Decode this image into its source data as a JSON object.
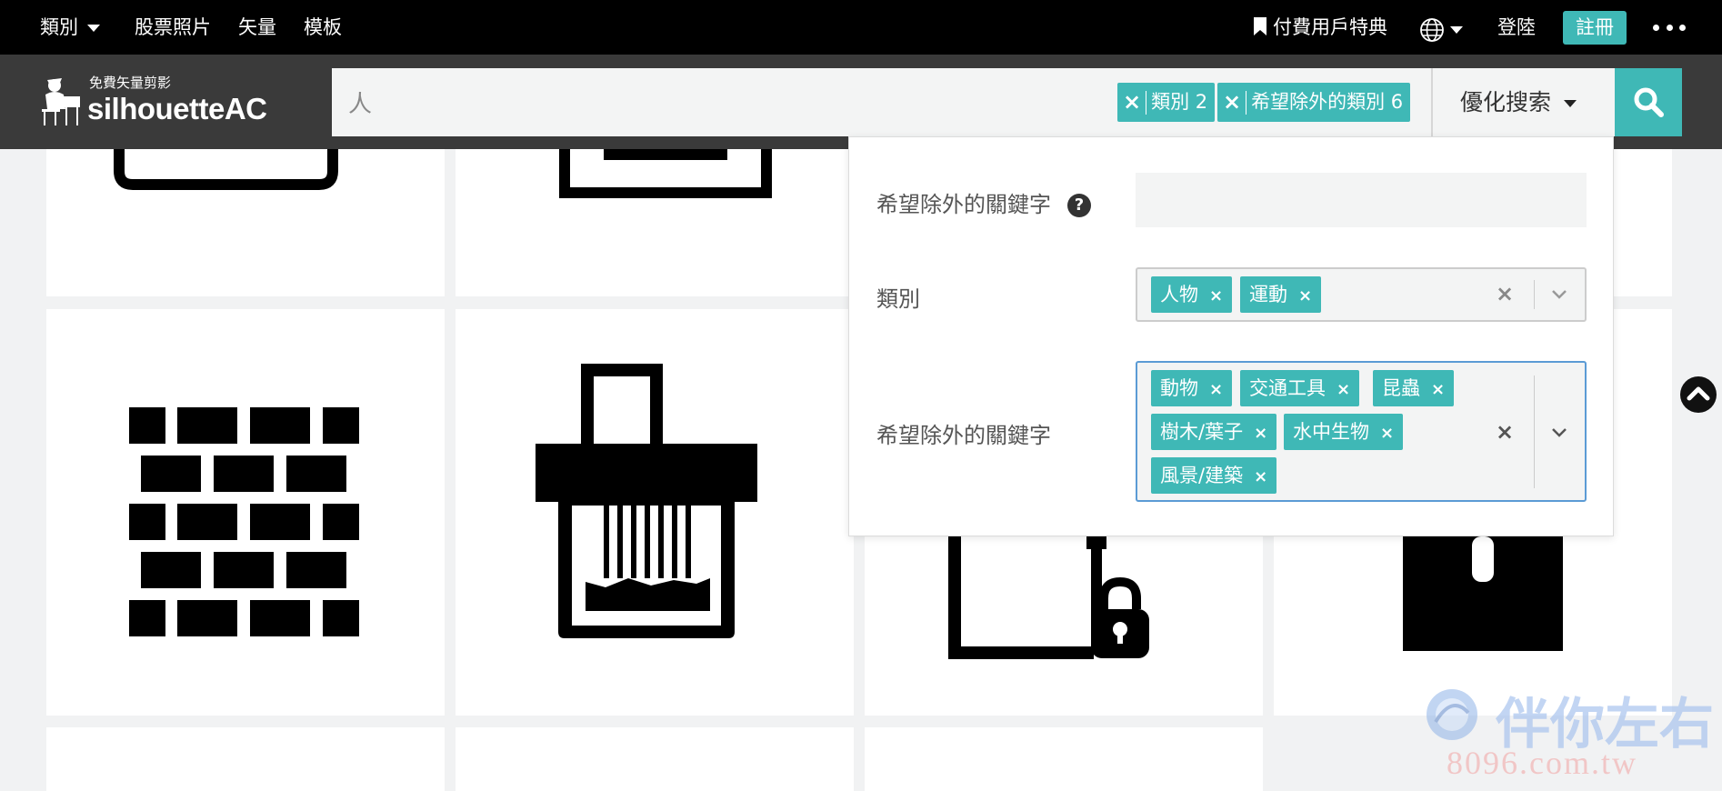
{
  "topnav": {
    "category": "類別",
    "photos": "股票照片",
    "vectors": "矢量",
    "templates": "模板",
    "premium": "付費用戶特典",
    "login": "登陸",
    "register": "註冊"
  },
  "logo": {
    "tagline": "免費矢量剪影",
    "name": "silhouetteAC"
  },
  "search": {
    "query": "人",
    "filters": [
      {
        "label": "類別 2"
      },
      {
        "label": "希望除外的類別 6"
      }
    ],
    "refine_label": "優化搜索"
  },
  "panel": {
    "exclude_keyword_label": "希望除外的關鍵字",
    "help": "?",
    "category_label": "類別",
    "category_tags": [
      "人物",
      "運動"
    ],
    "exclude_category_label": "希望除外的關鍵字",
    "exclude_tags": [
      "動物",
      "交通工具",
      "昆蟲",
      "樹木/葉子",
      "水中生物",
      "風景/建築"
    ],
    "tag_x": "×",
    "clear_x": "×"
  },
  "watermark": {
    "brand": "伴你左右",
    "url": "8096.com.tw"
  },
  "colors": {
    "accent": "#3fb8b6",
    "nav_bg": "#000000",
    "header_bg": "#3a3a3a",
    "focus_border": "#5b9bd5"
  },
  "icons": {
    "category_caret": "caret-down-icon",
    "premium": "bookmark-icon",
    "language": "globe-icon",
    "more": "more-dots-icon",
    "search": "search-icon",
    "help": "question-circle-icon",
    "scroll_top": "chevron-up-circle-icon"
  }
}
